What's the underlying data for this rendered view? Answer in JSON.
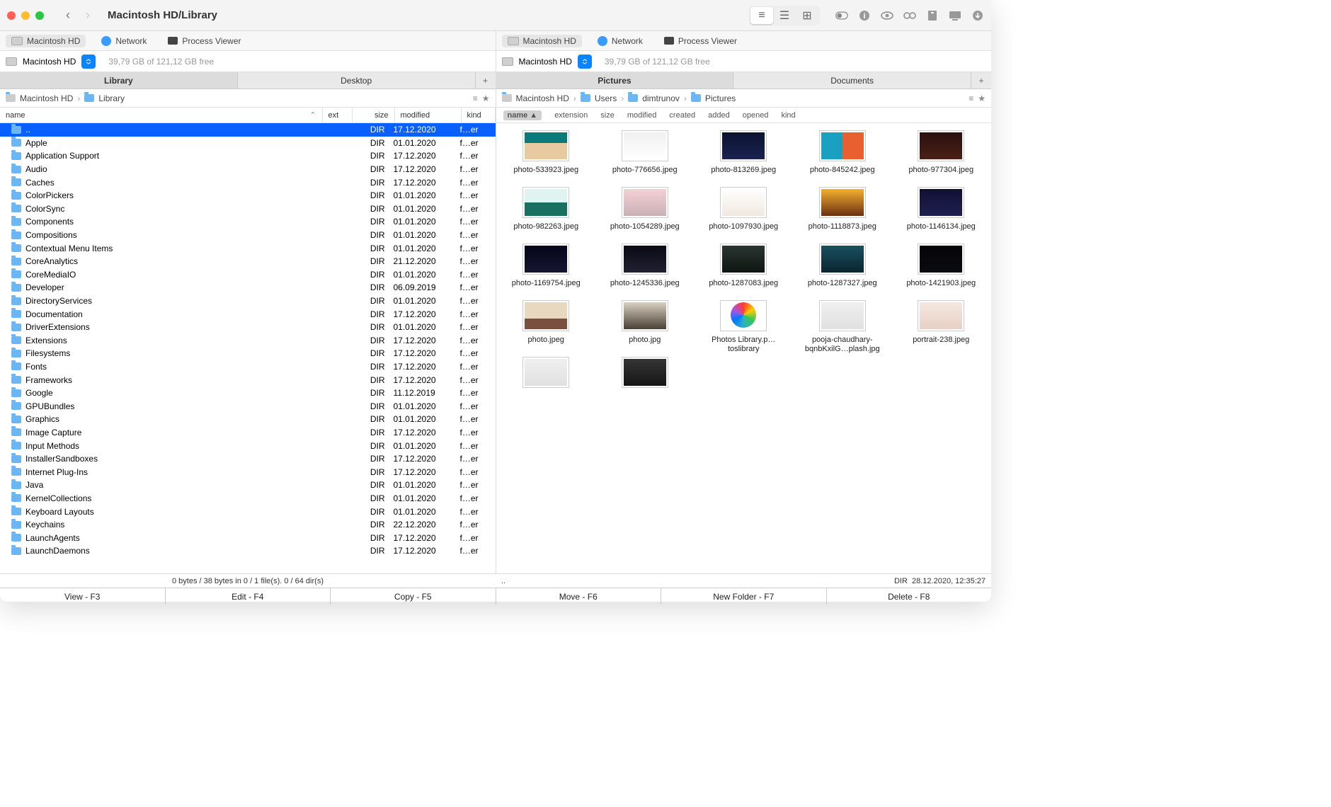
{
  "title": "Macintosh HD/Library",
  "toolbar": {
    "view_modes": [
      "list",
      "columns",
      "grid"
    ]
  },
  "sources": {
    "hd": "Macintosh HD",
    "network": "Network",
    "process": "Process Viewer"
  },
  "drive": {
    "name": "Macintosh HD",
    "free": "39,79 GB of 121,12 GB free"
  },
  "left": {
    "tabs": [
      "Library",
      "Desktop"
    ],
    "crumbs": [
      "Macintosh HD",
      "Library"
    ],
    "columns": {
      "name": "name",
      "ext": "ext",
      "size": "size",
      "mod": "modified",
      "kind": "kind"
    },
    "rows": [
      {
        "name": "..",
        "size": "DIR",
        "mod": "17.12.2020",
        "kind": "f…er",
        "sel": true
      },
      {
        "name": "Apple",
        "size": "DIR",
        "mod": "01.01.2020",
        "kind": "f…er"
      },
      {
        "name": "Application Support",
        "size": "DIR",
        "mod": "17.12.2020",
        "kind": "f…er"
      },
      {
        "name": "Audio",
        "size": "DIR",
        "mod": "17.12.2020",
        "kind": "f…er"
      },
      {
        "name": "Caches",
        "size": "DIR",
        "mod": "17.12.2020",
        "kind": "f…er"
      },
      {
        "name": "ColorPickers",
        "size": "DIR",
        "mod": "01.01.2020",
        "kind": "f…er"
      },
      {
        "name": "ColorSync",
        "size": "DIR",
        "mod": "01.01.2020",
        "kind": "f…er"
      },
      {
        "name": "Components",
        "size": "DIR",
        "mod": "01.01.2020",
        "kind": "f…er"
      },
      {
        "name": "Compositions",
        "size": "DIR",
        "mod": "01.01.2020",
        "kind": "f…er"
      },
      {
        "name": "Contextual Menu Items",
        "size": "DIR",
        "mod": "01.01.2020",
        "kind": "f…er"
      },
      {
        "name": "CoreAnalytics",
        "size": "DIR",
        "mod": "21.12.2020",
        "kind": "f…er"
      },
      {
        "name": "CoreMediaIO",
        "size": "DIR",
        "mod": "01.01.2020",
        "kind": "f…er"
      },
      {
        "name": "Developer",
        "size": "DIR",
        "mod": "06.09.2019",
        "kind": "f…er"
      },
      {
        "name": "DirectoryServices",
        "size": "DIR",
        "mod": "01.01.2020",
        "kind": "f…er"
      },
      {
        "name": "Documentation",
        "size": "DIR",
        "mod": "17.12.2020",
        "kind": "f…er"
      },
      {
        "name": "DriverExtensions",
        "size": "DIR",
        "mod": "01.01.2020",
        "kind": "f…er"
      },
      {
        "name": "Extensions",
        "size": "DIR",
        "mod": "17.12.2020",
        "kind": "f…er"
      },
      {
        "name": "Filesystems",
        "size": "DIR",
        "mod": "17.12.2020",
        "kind": "f…er"
      },
      {
        "name": "Fonts",
        "size": "DIR",
        "mod": "17.12.2020",
        "kind": "f…er"
      },
      {
        "name": "Frameworks",
        "size": "DIR",
        "mod": "17.12.2020",
        "kind": "f…er"
      },
      {
        "name": "Google",
        "size": "DIR",
        "mod": "11.12.2019",
        "kind": "f…er"
      },
      {
        "name": "GPUBundles",
        "size": "DIR",
        "mod": "01.01.2020",
        "kind": "f…er"
      },
      {
        "name": "Graphics",
        "size": "DIR",
        "mod": "01.01.2020",
        "kind": "f…er"
      },
      {
        "name": "Image Capture",
        "size": "DIR",
        "mod": "17.12.2020",
        "kind": "f…er"
      },
      {
        "name": "Input Methods",
        "size": "DIR",
        "mod": "01.01.2020",
        "kind": "f…er"
      },
      {
        "name": "InstallerSandboxes",
        "size": "DIR",
        "mod": "17.12.2020",
        "kind": "f…er"
      },
      {
        "name": "Internet Plug-Ins",
        "size": "DIR",
        "mod": "17.12.2020",
        "kind": "f…er"
      },
      {
        "name": "Java",
        "size": "DIR",
        "mod": "01.01.2020",
        "kind": "f…er"
      },
      {
        "name": "KernelCollections",
        "size": "DIR",
        "mod": "01.01.2020",
        "kind": "f…er"
      },
      {
        "name": "Keyboard Layouts",
        "size": "DIR",
        "mod": "01.01.2020",
        "kind": "f…er"
      },
      {
        "name": "Keychains",
        "size": "DIR",
        "mod": "22.12.2020",
        "kind": "f…er"
      },
      {
        "name": "LaunchAgents",
        "size": "DIR",
        "mod": "17.12.2020",
        "kind": "f…er"
      },
      {
        "name": "LaunchDaemons",
        "size": "DIR",
        "mod": "17.12.2020",
        "kind": "f…er"
      }
    ],
    "status": "0 bytes / 38 bytes in 0 / 1 file(s). 0 / 64 dir(s)"
  },
  "right": {
    "tabs": [
      "Pictures",
      "Documents"
    ],
    "crumbs": [
      "Macintosh HD",
      "Users",
      "dimtrunov",
      "Pictures"
    ],
    "sort": [
      "name",
      "extension",
      "size",
      "modified",
      "created",
      "added",
      "opened",
      "kind"
    ],
    "sort_active": "name",
    "thumbs": [
      {
        "label": "photo-533923.jpeg",
        "bg": "linear-gradient(180deg,#0a7a7a 40%,#e8caa0 40%)"
      },
      {
        "label": "photo-776656.jpeg",
        "bg": "linear-gradient(#f0f0f0,#ffffff)"
      },
      {
        "label": "photo-813269.jpeg",
        "bg": "linear-gradient(#0b1230,#1a2350)"
      },
      {
        "label": "photo-845242.jpeg",
        "bg": "linear-gradient(90deg,#1aa0c0 50%,#e86030 50%)"
      },
      {
        "label": "photo-977304.jpeg",
        "bg": "linear-gradient(#2a1010,#4a2015)"
      },
      {
        "label": "photo-982263.jpeg",
        "bg": "linear-gradient(180deg,#dff3f0 50%,#1a7060 50%)"
      },
      {
        "label": "photo-1054289.jpeg",
        "bg": "linear-gradient(#f5d0d5,#c8b0b5)"
      },
      {
        "label": "photo-1097930.jpeg",
        "bg": "linear-gradient(#ffffff,#f0e8e0)"
      },
      {
        "label": "photo-1118873.jpeg",
        "bg": "linear-gradient(#f5b030,#6a3010)"
      },
      {
        "label": "photo-1146134.jpeg",
        "bg": "linear-gradient(#101035,#202050)"
      },
      {
        "label": "photo-1169754.jpeg",
        "bg": "linear-gradient(#05051a,#151530)"
      },
      {
        "label": "photo-1245336.jpeg",
        "bg": "linear-gradient(#0a0a15,#202030)"
      },
      {
        "label": "photo-1287083.jpeg",
        "bg": "linear-gradient(#2a3530,#0f1512)"
      },
      {
        "label": "photo-1287327.jpeg",
        "bg": "linear-gradient(#1a5060,#0a2530)"
      },
      {
        "label": "photo-1421903.jpeg",
        "bg": "linear-gradient(#050508,#0a0a12)"
      },
      {
        "label": "photo.jpeg",
        "bg": "linear-gradient(180deg,#e8d8c0 60%,#7a5040 60%)"
      },
      {
        "label": "photo.jpg",
        "bg": "linear-gradient(#d8d0c0,#4a4035)"
      },
      {
        "label": "Photos Library.p…toslibrary",
        "bg": "conic-gradient(#ff3b30,#ffcc00,#34c759,#30b0c7,#007aff,#af52de,#ff3b30)",
        "round": true
      },
      {
        "label": "pooja-chaudhary-bqnbKxilG…plash.jpg",
        "bg": "linear-gradient(#f0f0f0,#e0e0e0)"
      },
      {
        "label": "portrait-238.jpeg",
        "bg": "linear-gradient(#f5e8e0,#e8d0c5)"
      },
      {
        "label": "",
        "bg": "linear-gradient(#f0f0f0,#e0e0e0)"
      },
      {
        "label": "",
        "bg": "linear-gradient(#353535,#151515)"
      }
    ],
    "status_left": "..",
    "status_right_dir": "DIR",
    "status_right_time": "28.12.2020, 12:35:27"
  },
  "actions": [
    "View - F3",
    "Edit - F4",
    "Copy - F5",
    "Move - F6",
    "New Folder - F7",
    "Delete - F8"
  ]
}
